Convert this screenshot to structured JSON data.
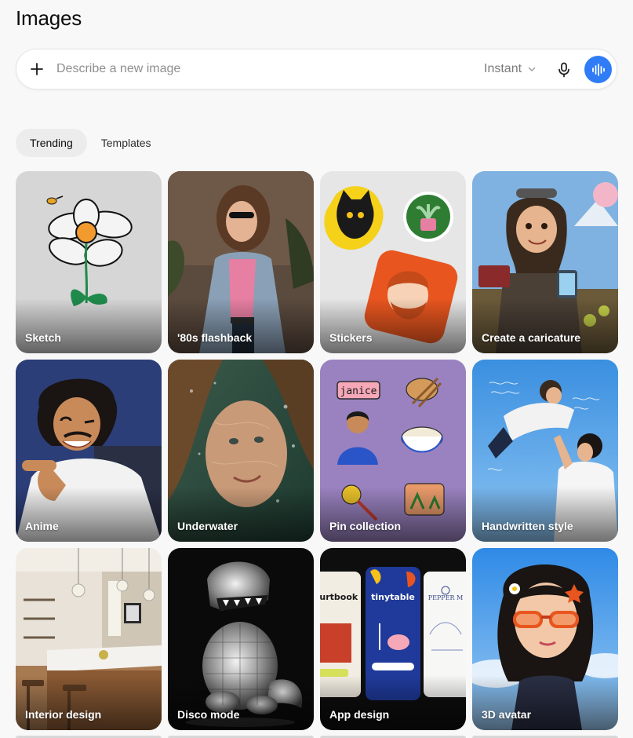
{
  "header": {
    "title": "Images"
  },
  "composer": {
    "placeholder": "Describe a new image",
    "value": "",
    "mode_label": "Instant"
  },
  "tabs": [
    {
      "label": "Trending",
      "active": true
    },
    {
      "label": "Templates",
      "active": false
    }
  ],
  "cards": [
    {
      "label": "Sketch"
    },
    {
      "label": "'80s flashback"
    },
    {
      "label": "Stickers"
    },
    {
      "label": "Create a caricature"
    },
    {
      "label": "Anime"
    },
    {
      "label": "Underwater"
    },
    {
      "label": "Pin collection"
    },
    {
      "label": "Handwritten style"
    },
    {
      "label": "Interior design"
    },
    {
      "label": "Disco mode"
    },
    {
      "label": "App design"
    },
    {
      "label": "3D avatar"
    }
  ],
  "art_text": {
    "pin_name": "janice",
    "app_brand_1": "ourtbook",
    "app_brand_2": "tinytable",
    "app_brand_3": "PEPPER M"
  },
  "colors": {
    "accent": "#2f7cf6",
    "tab_active_bg": "#ececec"
  },
  "icons": {
    "add": "plus-icon",
    "mode_dropdown": "chevron-down-icon",
    "mic": "microphone-icon",
    "voice": "voice-waveform-icon"
  }
}
